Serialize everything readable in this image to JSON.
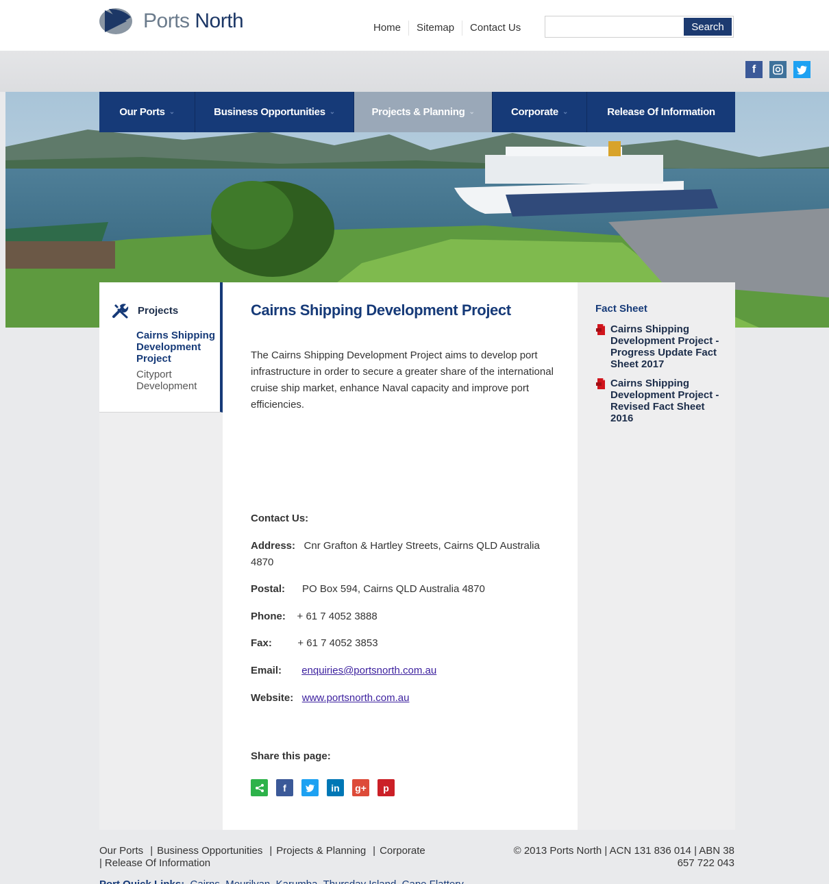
{
  "brand": {
    "part1": "Ports",
    "part2": "North"
  },
  "toplinks": [
    "Home",
    "Sitemap",
    "Contact Us"
  ],
  "search": {
    "placeholder": "",
    "button": "Search"
  },
  "social": [
    {
      "name": "facebook",
      "glyph": "f",
      "color": "#3b5998"
    },
    {
      "name": "instagram",
      "glyph": "◙",
      "color": "#3f729b"
    },
    {
      "name": "twitter",
      "glyph": "t",
      "color": "#1da1f2"
    }
  ],
  "nav": [
    {
      "label": "Our Ports",
      "active": false
    },
    {
      "label": "Business Opportunities",
      "active": false
    },
    {
      "label": "Projects & Planning",
      "active": true
    },
    {
      "label": "Corporate",
      "active": false
    },
    {
      "label": "Release Of Information",
      "active": false
    }
  ],
  "sidebar": {
    "heading": "Projects",
    "items": [
      "Cairns Shipping Development Project",
      "Cityport Development"
    ]
  },
  "main": {
    "title": "Cairns Shipping Development Project",
    "intro": "The Cairns Shipping Development Project aims to develop port infrastructure in order to secure a greater share of the international cruise ship market, enhance Naval capacity and improve port efficiencies."
  },
  "contact": {
    "heading": "Contact Us:",
    "address_label": "Address:",
    "address": "Cnr Grafton & Hartley Streets, Cairns QLD Australia 4870",
    "postal_label": "Postal:",
    "postal": "PO Box 594, Cairns QLD Australia 4870",
    "phone_label": "Phone:",
    "phone": "+ 61 7 4052 3888",
    "fax_label": "Fax:",
    "fax": "+ 61 7 4052 3853",
    "email_label": "Email:",
    "email": "enquiries@portsnorth.com.au",
    "website_label": "Website:",
    "website": "www.portsnorth.com.au"
  },
  "share": {
    "heading": "Share this page:",
    "buttons": [
      {
        "name": "share",
        "glyph": "<",
        "color": "#2db24a"
      },
      {
        "name": "facebook",
        "glyph": "f",
        "color": "#3b5998"
      },
      {
        "name": "twitter",
        "glyph": "t",
        "color": "#1da1f2"
      },
      {
        "name": "linkedin",
        "glyph": "in",
        "color": "#0077b5"
      },
      {
        "name": "googleplus",
        "glyph": "g+",
        "color": "#dd4b39"
      },
      {
        "name": "pinterest",
        "glyph": "p",
        "color": "#cb2027"
      }
    ]
  },
  "factsheet": {
    "heading": "Fact Sheet",
    "items": [
      "Cairns Shipping Development Project - Progress Update Fact Sheet 2017",
      "Cairns Shipping Development Project - Revised Fact Sheet 2016"
    ]
  },
  "footer": {
    "links": [
      "Our Ports",
      "Business Opportunities",
      "Projects & Planning",
      "Corporate",
      "Release Of Information"
    ],
    "copyright": "© 2013 Ports North | ACN 131 836 014 | ABN 38 657 722 043",
    "quick_label": "Port Quick Links:",
    "quick_links": [
      "Cairns",
      "Mourilyan",
      "Karumba",
      "Thursday Island",
      "Cape Flattery"
    ]
  }
}
